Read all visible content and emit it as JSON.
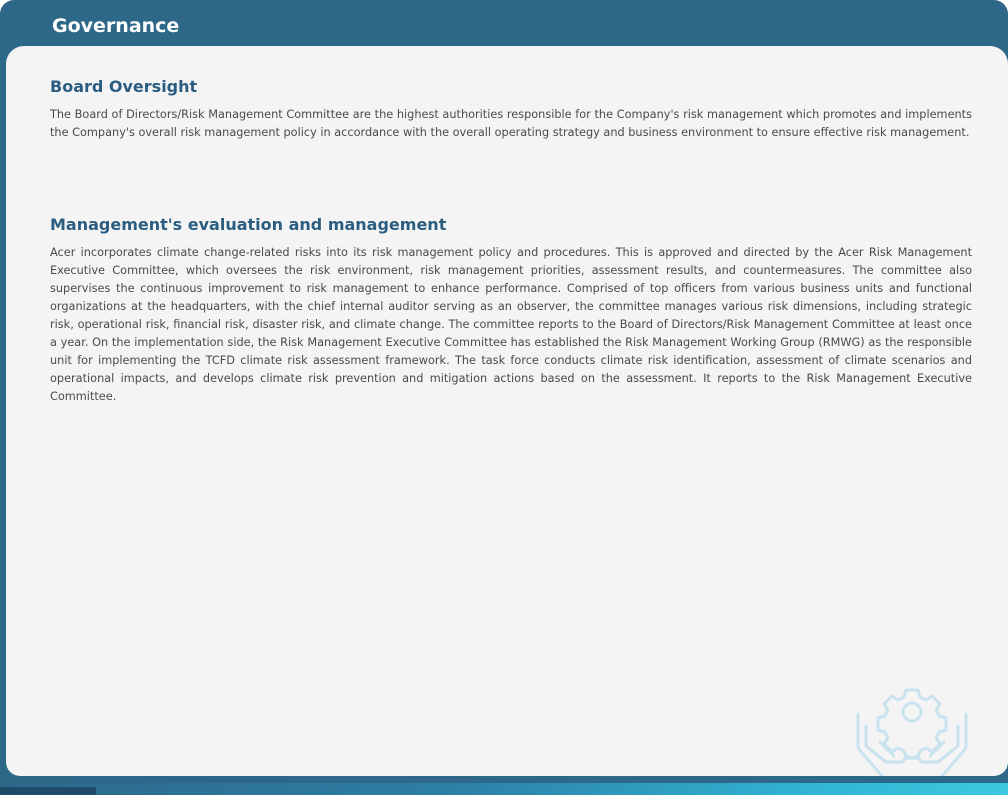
{
  "header": {
    "title": "Governance"
  },
  "sections": [
    {
      "heading": "Board Oversight",
      "body": "The Board of Directors/Risk Management Committee are the highest authorities responsible for the Company's risk management which promotes and implements the Company's overall risk management policy in accordance with the overall operating strategy and business environment to ensure effective risk management."
    },
    {
      "heading": "Management's evaluation and management",
      "body": "Acer incorporates climate change-related risks into its risk management policy and procedures. This is approved and directed by the Acer Risk Management Executive Committee, which oversees the risk environment, risk management priorities, assessment results, and countermeasures. The committee also supervises the continuous improvement to risk management to enhance performance. Comprised of top officers from various business units and functional organizations at the headquarters, with the chief internal auditor serving as an observer, the committee manages various risk dimensions, including strategic risk, operational risk, financial risk, disaster risk, and climate change. The committee reports to the Board of Directors/Risk Management Committee at least once a year. On the implementation side, the Risk Management Executive Committee has established the Risk Management Working Group (RMWG) as the responsible unit for implementing the TCFD climate risk assessment framework. The task force conducts climate risk identification, assessment of climate scenarios and operational impacts, and develops climate risk prevention and mitigation actions based on the assessment. It reports to the Risk Management Executive Committee."
    }
  ],
  "decoration": {
    "watermark_icon": "hands-holding-gear-icon"
  },
  "colors": {
    "header_background": "#2d6889",
    "card_background": "#f4f4f4",
    "heading_text": "#2b5d80",
    "body_text": "#4a4a4a",
    "watermark_stroke": "#c8e3ee"
  }
}
